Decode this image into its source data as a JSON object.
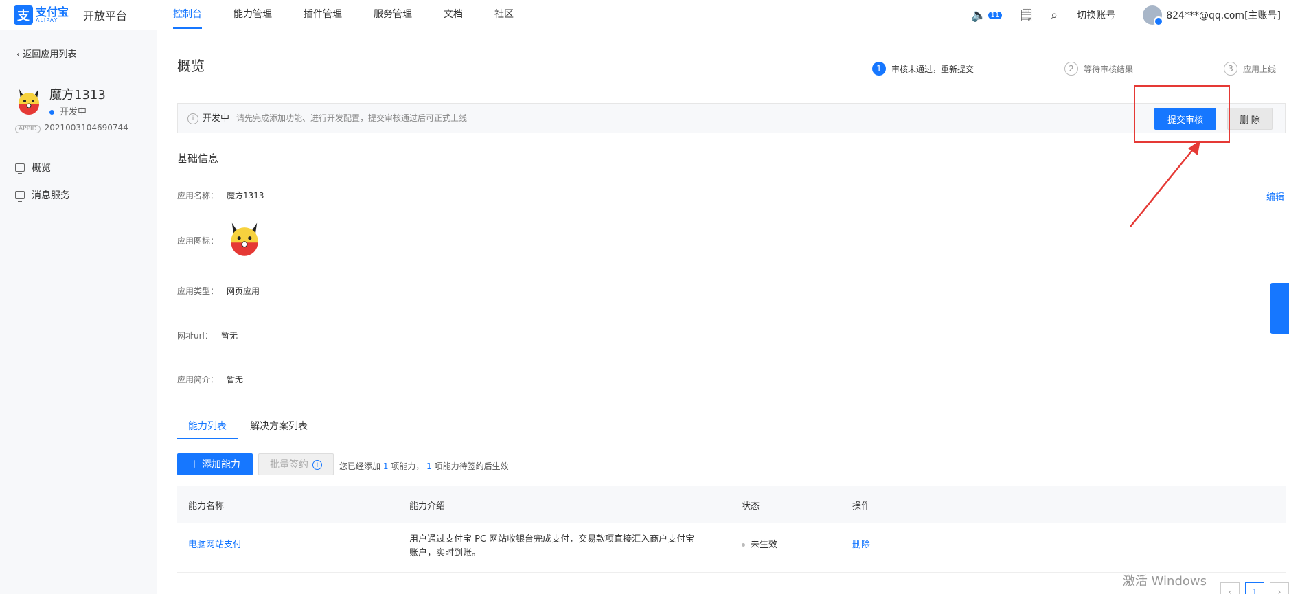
{
  "header": {
    "logo_cn": "支付宝",
    "logo_en": "ALIPAY",
    "platform": "开放平台",
    "nav": [
      "控制台",
      "能力管理",
      "插件管理",
      "服务管理",
      "文档",
      "社区"
    ],
    "notification_count": "11",
    "switch_account": "切换账号",
    "account": "824***@qq.com[主账号]"
  },
  "sidebar": {
    "back_label": "返回应用列表",
    "app_name": "魔方1313",
    "app_status": "开发中",
    "appid_tag": "APPID",
    "appid": "2021003104690744",
    "menu": [
      "概览",
      "消息服务"
    ]
  },
  "main": {
    "title": "概览",
    "steps": [
      {
        "num": "1",
        "label": "审核未通过，重新提交"
      },
      {
        "num": "2",
        "label": "等待审核结果"
      },
      {
        "num": "3",
        "label": "应用上线"
      }
    ],
    "status_label": "开发中",
    "status_hint": "请先完成添加功能、进行开发配置，提交审核通过后可正式上线",
    "submit_label": "提交审核",
    "delete_label": "删 除",
    "basic_info_title": "基础信息",
    "edit_label": "编辑",
    "fields": {
      "name_label": "应用名称：",
      "name_value": "魔方1313",
      "icon_label": "应用图标：",
      "type_label": "应用类型：",
      "type_value": "网页应用",
      "url_label": "网址url：",
      "url_value": "暂无",
      "intro_label": "应用简介：",
      "intro_value": "暂无"
    },
    "tabs": [
      "能力列表",
      "解决方案列表"
    ],
    "add_label": "添加能力",
    "batch_label": "批量签约",
    "added_note_prefix": "您已经添加",
    "added_count": "1",
    "added_note_mid": "项能力，",
    "pending_count": "1",
    "added_note_suffix": "项能力待签约后生效",
    "table": {
      "headers": [
        "能力名称",
        "能力介绍",
        "状态",
        "操作"
      ],
      "rows": [
        {
          "name": "电脑网站支付",
          "desc": "用户通过支付宝 PC 网站收银台完成支付，交易款项直接汇入商户支付宝账户，实时到账。",
          "status": "未生效",
          "action": "删除"
        }
      ]
    }
  },
  "watermark": "激活 Windows",
  "pagination": {
    "current": "1"
  },
  "colors": {
    "primary": "#1677ff",
    "highlight": "#e53935"
  }
}
